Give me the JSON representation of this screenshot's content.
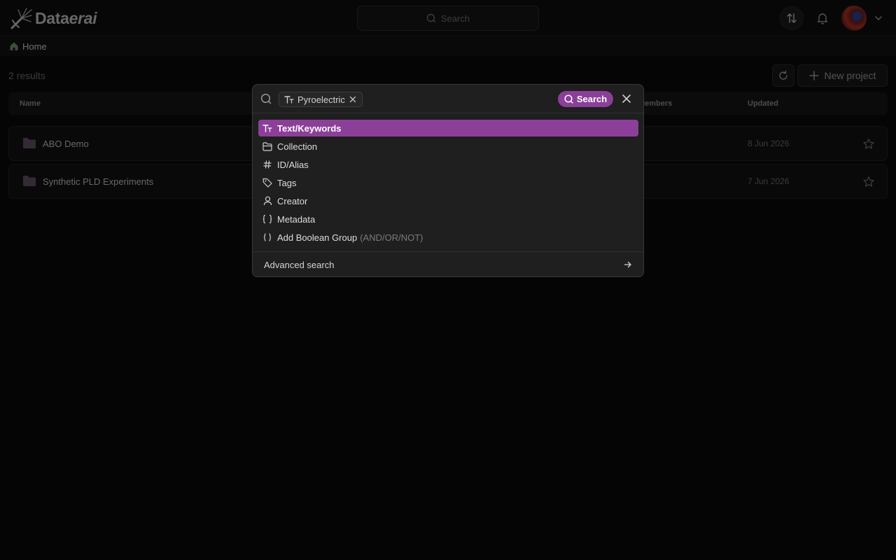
{
  "app": {
    "logo_prefix": "Data",
    "logo_italic": "erai"
  },
  "topbar": {
    "search_placeholder": "Search"
  },
  "breadcrumb": {
    "home_label": "Home"
  },
  "main": {
    "results_count": "2 results",
    "new_project_label": "New project",
    "columns": {
      "name": "Name",
      "members": "Members",
      "updated": "Updated"
    },
    "rows": [
      {
        "name": "ABO Demo",
        "updated": "8 Jun 2026"
      },
      {
        "name": "Synthetic PLD Experiments",
        "updated": "7 Jun 2026"
      }
    ]
  },
  "search_modal": {
    "chip_label": "Pyroelectric",
    "search_button": "Search",
    "menu_items": [
      {
        "label": "Text/Keywords",
        "icon": "text-type-icon",
        "active": true
      },
      {
        "label": "Collection",
        "icon": "folder-icon"
      },
      {
        "label": "ID/Alias",
        "icon": "hash-icon"
      },
      {
        "label": "Tags",
        "icon": "tag-icon"
      },
      {
        "label": "Creator",
        "icon": "user-icon"
      },
      {
        "label": "Metadata",
        "icon": "braces-icon"
      },
      {
        "label": "Add Boolean Group",
        "hint": "(AND/OR/NOT)",
        "icon": "parentheses-icon"
      }
    ],
    "footer_label": "Advanced search"
  },
  "colors": {
    "accent": "#8c3f99",
    "background": "#0a0a0a",
    "modal_background": "#1f1f1f",
    "folder": "#5e4d62"
  }
}
